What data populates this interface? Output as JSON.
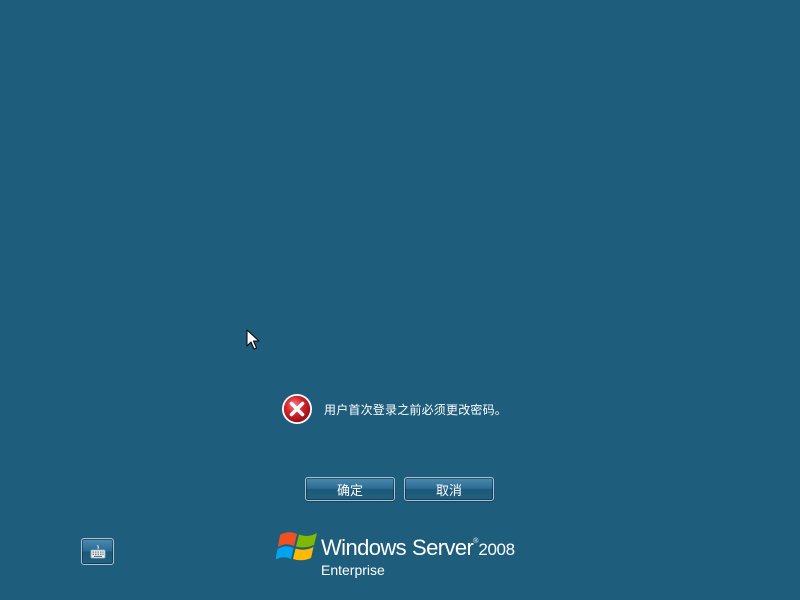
{
  "screen": {
    "background_color": "#1e5d7b"
  },
  "message": {
    "icon": "error-icon",
    "text": "用户首次登录之前必须更改密码。"
  },
  "buttons": {
    "ok_label": "确定",
    "cancel_label": "取消"
  },
  "accessibility": {
    "keyboard_icon": "keyboard-icon"
  },
  "branding": {
    "windows": "Windows",
    "server": "Server",
    "reg": "®",
    "year": "2008",
    "edition": "Enterprise"
  }
}
